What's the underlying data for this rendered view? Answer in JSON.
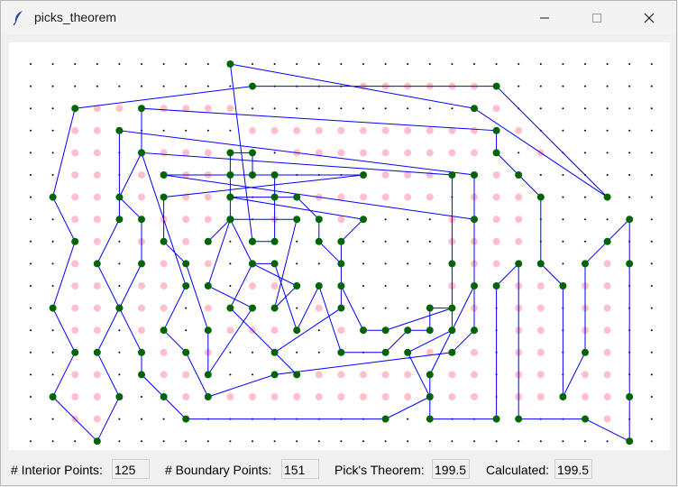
{
  "window": {
    "title": "picks_theorem",
    "icon": "feather-icon",
    "controls": [
      "minimize-icon",
      "maximize-icon",
      "close-icon"
    ]
  },
  "colors": {
    "grid_dot": "#000000",
    "interior_point": "#ffc0cb",
    "boundary_point": "#006400",
    "polygon_edge": "#0000ff",
    "canvas_bg": "#ffffff"
  },
  "status": {
    "interior_label": "# Interior Points:",
    "interior_value": "125",
    "boundary_label": "# Boundary Points:",
    "boundary_value": "151",
    "picks_label": "Pick's Theorem:",
    "picks_value": "199.5",
    "calc_label": "Calculated:",
    "calc_value": "199.5"
  },
  "polygon": {
    "vertices": [
      [
        9,
        0
      ],
      [
        20,
        2
      ],
      [
        26,
        6
      ],
      [
        21,
        1
      ],
      [
        10,
        1
      ],
      [
        2,
        2
      ],
      [
        1,
        6
      ],
      [
        2,
        8
      ],
      [
        1,
        11
      ],
      [
        2,
        13
      ],
      [
        1,
        15
      ],
      [
        3,
        17
      ],
      [
        4,
        15
      ],
      [
        3,
        13
      ],
      [
        4,
        11
      ],
      [
        3,
        9
      ],
      [
        4,
        7
      ],
      [
        4,
        3
      ],
      [
        20,
        5
      ],
      [
        20,
        10
      ],
      [
        18,
        14
      ],
      [
        18,
        16
      ],
      [
        21,
        16
      ],
      [
        21,
        10
      ],
      [
        22,
        9
      ],
      [
        22,
        16
      ],
      [
        25,
        16
      ],
      [
        27,
        17
      ],
      [
        27,
        15
      ],
      [
        27,
        9
      ],
      [
        27,
        7
      ],
      [
        26,
        8
      ],
      [
        25,
        9
      ],
      [
        25,
        13
      ],
      [
        24,
        15
      ],
      [
        24,
        10
      ],
      [
        23,
        9
      ],
      [
        23,
        6
      ],
      [
        22,
        5
      ],
      [
        21,
        4
      ],
      [
        21,
        3
      ],
      [
        5,
        2
      ],
      [
        5,
        4
      ],
      [
        4,
        6
      ],
      [
        5,
        7
      ],
      [
        5,
        9
      ],
      [
        4,
        11
      ],
      [
        5,
        13
      ],
      [
        5,
        14
      ],
      [
        6,
        15
      ],
      [
        7,
        16
      ],
      [
        16,
        16
      ],
      [
        18,
        15
      ],
      [
        17,
        13
      ],
      [
        19,
        12
      ],
      [
        19,
        9
      ],
      [
        19,
        5
      ],
      [
        5,
        4
      ],
      [
        7,
        10
      ],
      [
        6,
        12
      ],
      [
        7,
        13
      ],
      [
        8,
        15
      ],
      [
        11,
        14
      ],
      [
        19,
        13
      ],
      [
        20,
        12
      ],
      [
        20,
        7
      ],
      [
        6,
        5
      ],
      [
        15,
        5
      ],
      [
        6,
        6
      ],
      [
        6,
        8
      ],
      [
        7,
        9
      ],
      [
        8,
        12
      ],
      [
        8,
        14
      ],
      [
        10,
        11
      ],
      [
        8,
        10
      ],
      [
        9,
        7
      ],
      [
        12,
        7
      ],
      [
        11,
        11
      ],
      [
        12,
        10
      ],
      [
        10,
        9
      ],
      [
        9,
        11
      ],
      [
        12,
        14
      ],
      [
        11,
        13
      ],
      [
        14,
        11
      ],
      [
        14,
        8
      ],
      [
        15,
        7
      ],
      [
        9,
        6
      ],
      [
        9,
        7
      ],
      [
        8,
        8
      ],
      [
        9,
        7
      ],
      [
        10,
        9
      ],
      [
        11,
        9
      ],
      [
        12,
        12
      ],
      [
        13,
        10
      ],
      [
        14,
        13
      ],
      [
        16,
        13
      ],
      [
        17,
        12
      ],
      [
        18,
        12
      ],
      [
        18,
        11
      ],
      [
        19,
        11
      ],
      [
        16,
        12
      ],
      [
        15,
        12
      ],
      [
        14,
        10
      ],
      [
        14,
        9
      ],
      [
        13,
        8
      ],
      [
        13,
        7
      ],
      [
        12,
        6
      ],
      [
        9,
        6
      ],
      [
        9,
        5
      ],
      [
        9,
        4
      ],
      [
        10,
        4
      ],
      [
        10,
        5
      ],
      [
        11,
        5
      ],
      [
        11,
        6
      ],
      [
        11,
        8
      ],
      [
        10,
        8
      ],
      [
        10,
        8
      ]
    ]
  }
}
